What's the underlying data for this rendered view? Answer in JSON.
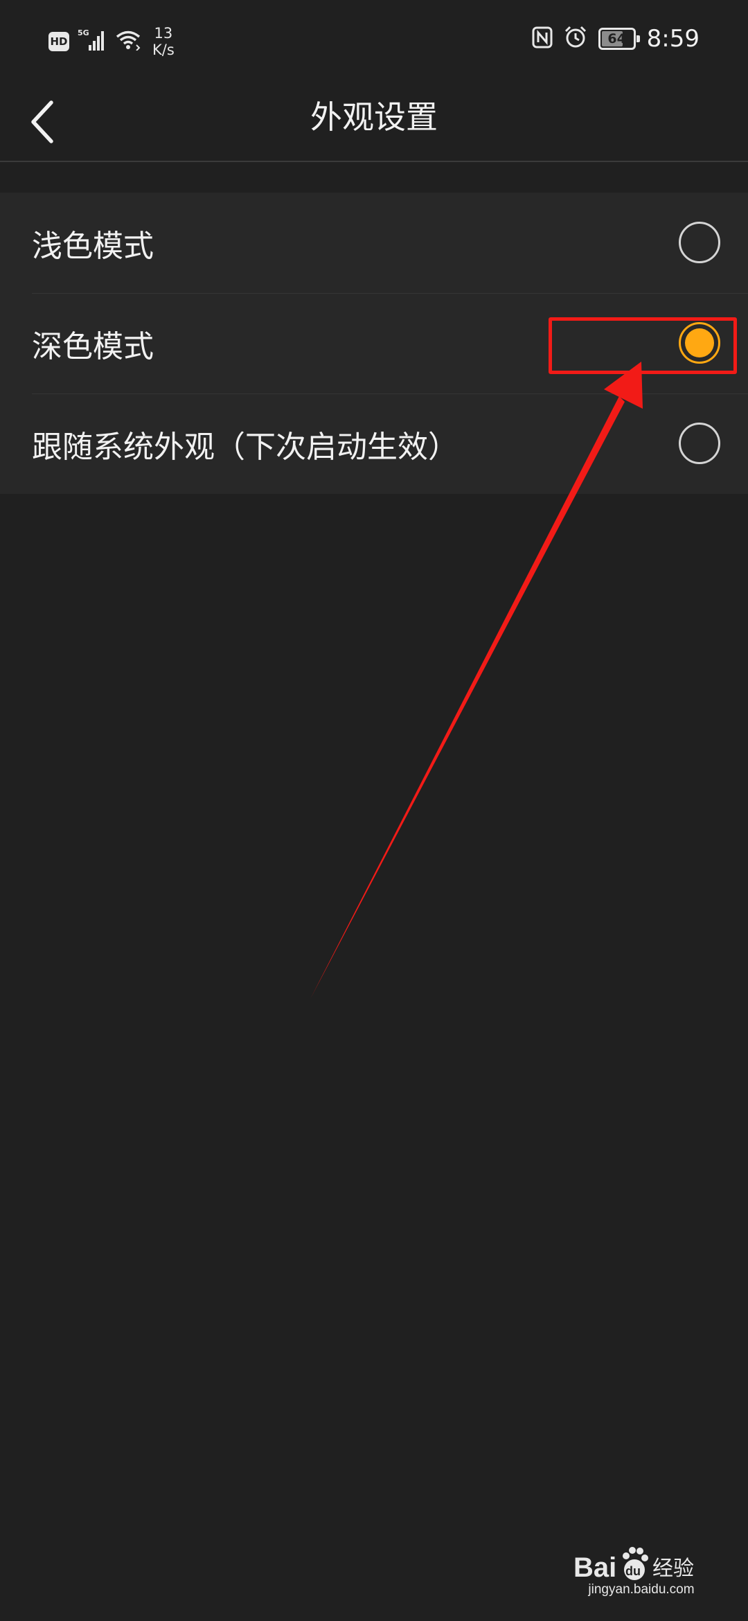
{
  "status_bar": {
    "hd_label": "HD",
    "network_type": "5G",
    "net_speed_value": "13",
    "net_speed_unit": "K/s",
    "battery_percent": "64",
    "time": "8:59",
    "icons": [
      "hd-icon",
      "signal-icon",
      "wifi-icon",
      "nfc-icon",
      "alarm-icon",
      "battery-icon"
    ]
  },
  "header": {
    "title": "外观设置",
    "back_icon": "chevron-left-icon"
  },
  "options": [
    {
      "label": "浅色模式",
      "selected": false
    },
    {
      "label": "深色模式",
      "selected": true
    },
    {
      "label": "跟随系统外观（下次启动生效）",
      "selected": false
    }
  ],
  "colors": {
    "background": "#202020",
    "list_background": "#282828",
    "accent": "#ffa812",
    "annotation": "#f21b17"
  },
  "watermark": {
    "logo_text": "Baidu经验",
    "url": "jingyan.baidu.com"
  }
}
